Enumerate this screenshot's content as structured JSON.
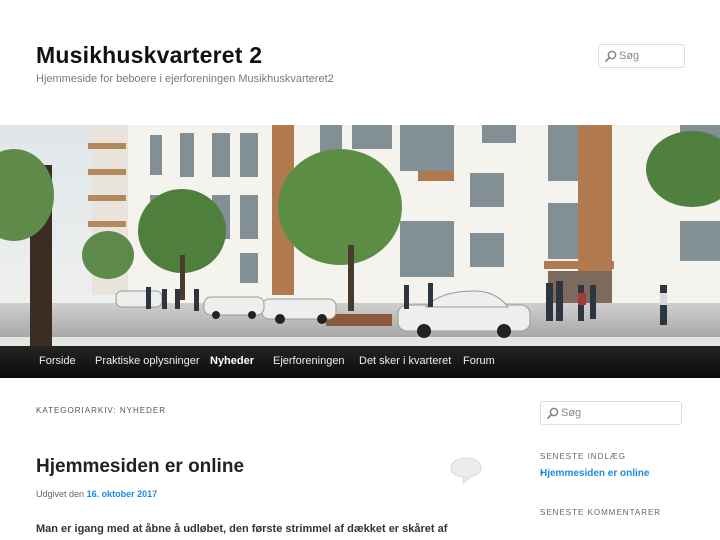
{
  "site": {
    "title": "Musikhuskvarteret 2",
    "description": "Hjemmeside for beboere i ejerforeningen Musikhuskvarteret2"
  },
  "search": {
    "top_placeholder": "Søg",
    "sidebar_placeholder": "Søg"
  },
  "nav": {
    "items": [
      {
        "label": "Forside",
        "current": false
      },
      {
        "label": "Praktiske oplysninger",
        "current": false
      },
      {
        "label": "Nyheder",
        "current": true
      },
      {
        "label": "Ejerforeningen",
        "current": false
      },
      {
        "label": "Det sker i kvarteret",
        "current": false
      },
      {
        "label": "Forum",
        "current": false
      }
    ]
  },
  "archive": {
    "title": "KATEGORIARKIV: NYHEDER"
  },
  "post": {
    "title": "Hjemmesiden er online",
    "meta_prefix": "Udgivet den",
    "date": "16. oktober 2017",
    "excerpt": "Man er igang med at åbne å udløbet, den første strimmel af dækket er skåret af"
  },
  "sidebar": {
    "recent_title": "SENESTE INDLÆG",
    "recent_posts": [
      "Hjemmesiden er online"
    ],
    "comments_title": "SENESTE KOMMENTARER"
  },
  "colors": {
    "link": "#1b8be0",
    "nav_background": "#111111"
  },
  "icons": {
    "search": "search-icon",
    "comment": "comment-bubble-icon"
  }
}
